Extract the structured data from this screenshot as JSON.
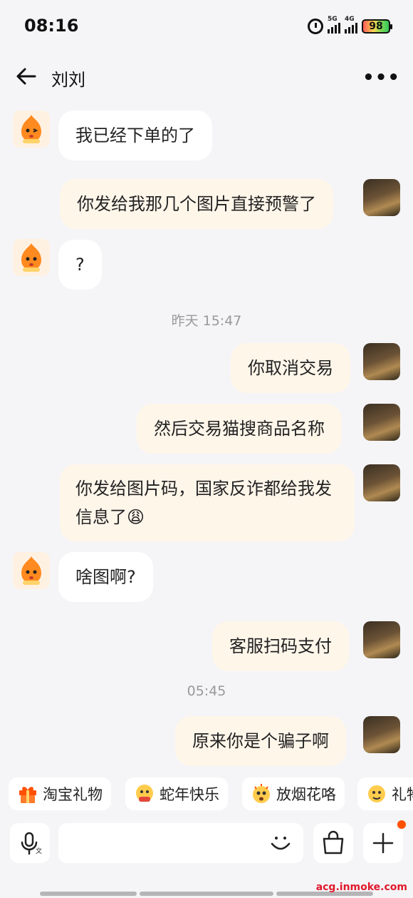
{
  "status_bar": {
    "time": "08:16",
    "network_1": "5G",
    "network_2": "4G",
    "battery": "98"
  },
  "header": {
    "title": "刘刘",
    "back_icon": "arrow-left-icon",
    "more_icon": "more-dots-icon"
  },
  "messages": [
    {
      "from": "contact",
      "text": "我已经下单的了"
    },
    {
      "from": "me",
      "text": "你发给我那几个图片直接预警了"
    },
    {
      "from": "contact",
      "text": "?"
    },
    {
      "type": "timestamp",
      "text": "昨天  15:47"
    },
    {
      "from": "me",
      "text": "你取消交易"
    },
    {
      "from": "me",
      "text": "然后交易猫搜商品名称"
    },
    {
      "from": "me",
      "text": "你发给图片码，国家反诈都给我发信息了",
      "emoji": "😩"
    },
    {
      "from": "contact",
      "text": "啥图啊?"
    },
    {
      "from": "me",
      "text": "客服扫码支付"
    },
    {
      "type": "timestamp",
      "text": "05:45"
    },
    {
      "from": "me",
      "text": "原来你是个骗子啊"
    }
  ],
  "quick_replies": [
    {
      "label": "淘宝礼物",
      "icon": "gift-icon"
    },
    {
      "label": "蛇年快乐",
      "icon": "snake-emoji-icon"
    },
    {
      "label": "放烟花咯",
      "icon": "firework-emoji-icon"
    },
    {
      "label": "礼物",
      "icon": "gift-emoji-icon"
    }
  ],
  "input_bar": {
    "voice_icon": "microphone-icon",
    "placeholder": "",
    "emoji_icon": "smiley-icon",
    "shop_icon": "shopping-bag-icon",
    "plus_icon": "plus-icon"
  },
  "watermark": "acg.inmoke.com",
  "colors": {
    "background": "#f5f5f7",
    "incoming_bubble": "#ffffff",
    "outgoing_bubble": "#fff6ea",
    "accent": "#ff5000"
  }
}
